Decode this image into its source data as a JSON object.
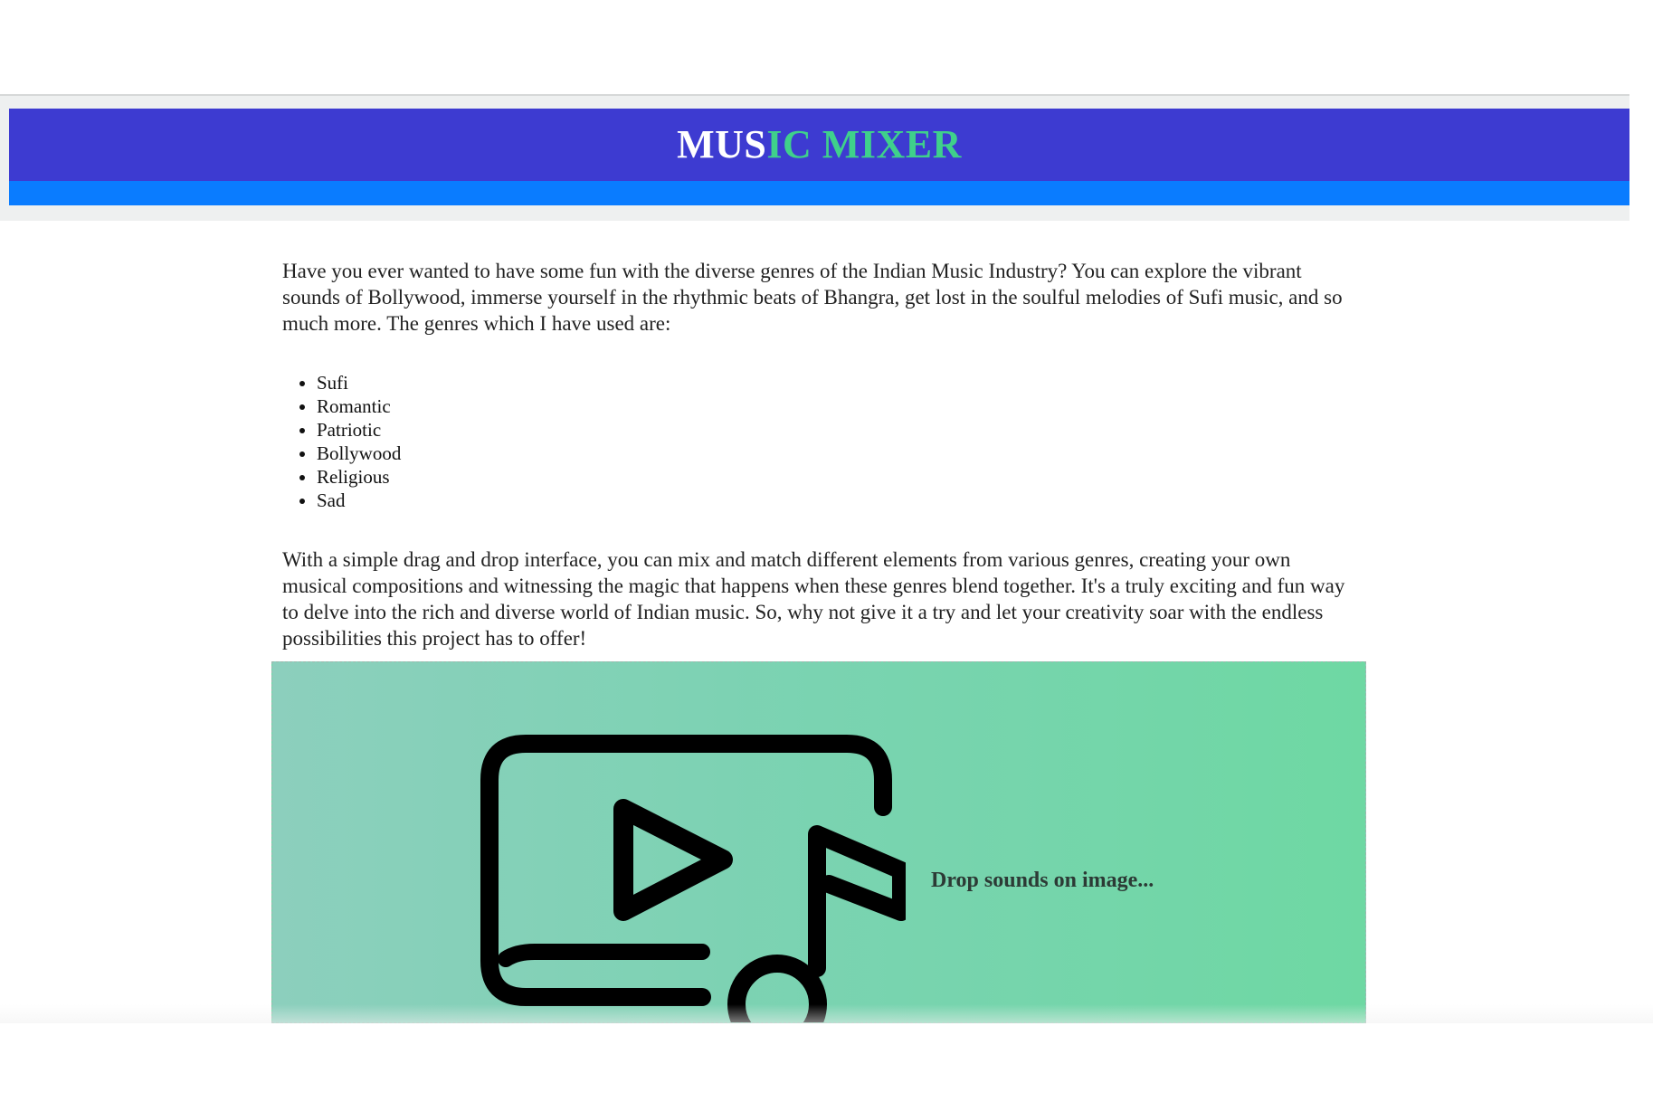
{
  "header": {
    "title_part_white": "MUS",
    "title_part_green": "IC MIXER"
  },
  "colors": {
    "header_bg": "#3d3bd1",
    "header_underbar": "#0a7cff",
    "title_green": "#3fd08b",
    "dropzone_left": "#8ccfbd",
    "dropzone_right": "#6ed8a3"
  },
  "main": {
    "intro": "Have you ever wanted to have some fun with the diverse genres of the Indian Music Industry? You can explore the vibrant sounds of Bollywood, immerse yourself in the rhythmic beats of Bhangra, get lost in the soulful melodies of Sufi music, and so much more. The genres which I have used are:",
    "genres": [
      "Sufi",
      "Romantic",
      "Patriotic",
      "Bollywood",
      "Religious",
      "Sad"
    ],
    "outro": "With a simple drag and drop interface, you can mix and match different elements from various genres, creating your own musical compositions and witnessing the magic that happens when these genres blend together. It's a truly exciting and fun way to delve into the rich and diverse world of Indian music. So, why not give it a try and let your creativity soar with the endless possibilities this project has to offer!"
  },
  "drop_zone": {
    "icon": "music-video-library-icon",
    "label": "Drop sounds on image..."
  }
}
